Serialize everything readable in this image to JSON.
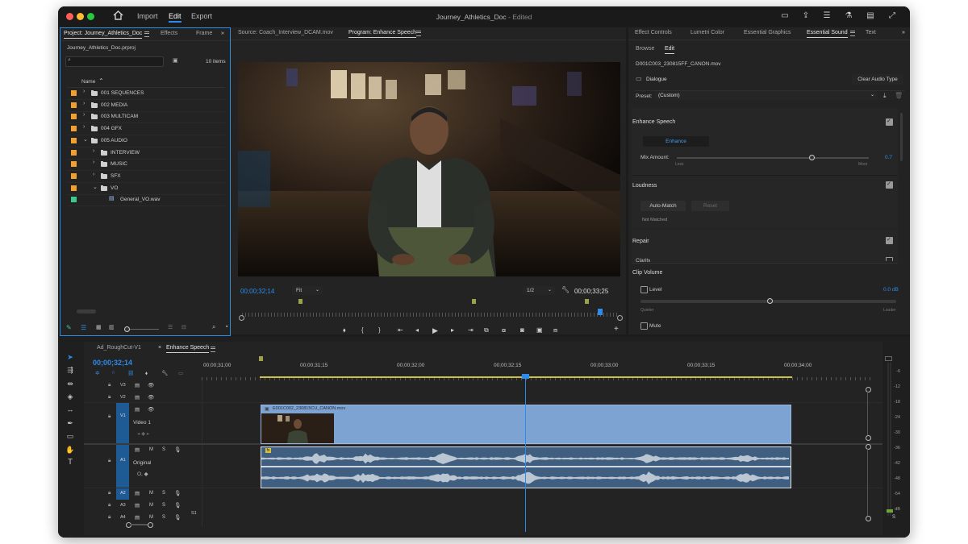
{
  "window": {
    "title": "Journey_Athletics_Doc",
    "edited": "- Edited",
    "menu": [
      "Import",
      "Edit",
      "Export"
    ],
    "active_menu": "Edit"
  },
  "project": {
    "tabs": [
      "Project: Journey_Athletics_Doc",
      "Effects",
      "Frame"
    ],
    "file": "Journey_Athletics_Doc.prproj",
    "count": "10 items",
    "column_name": "Name",
    "items": [
      {
        "label": "001 SEQUENCES",
        "color": "#f0a030",
        "indent": 0,
        "open": false,
        "type": "folder"
      },
      {
        "label": "002 MEDIA",
        "color": "#f0a030",
        "indent": 0,
        "open": false,
        "type": "folder"
      },
      {
        "label": "003 MULTICAM",
        "color": "#f0a030",
        "indent": 0,
        "open": false,
        "type": "folder"
      },
      {
        "label": "004 GFX",
        "color": "#f0a030",
        "indent": 0,
        "open": false,
        "type": "folder"
      },
      {
        "label": "005 AUDIO",
        "color": "#f0a030",
        "indent": 0,
        "open": true,
        "type": "folder"
      },
      {
        "label": "INTERVIEW",
        "color": "#f0a030",
        "indent": 1,
        "open": false,
        "type": "folder"
      },
      {
        "label": "MUSIC",
        "color": "#f0a030",
        "indent": 1,
        "open": false,
        "type": "folder"
      },
      {
        "label": "SFX",
        "color": "#f0a030",
        "indent": 1,
        "open": false,
        "type": "folder"
      },
      {
        "label": "VO",
        "color": "#f0a030",
        "indent": 1,
        "open": true,
        "type": "folder"
      },
      {
        "label": "General_VO.wav",
        "color": "#3cc98a",
        "indent": 2,
        "open": false,
        "type": "audio"
      }
    ]
  },
  "monitor": {
    "tabs": [
      "Source: Coach_Interview_DCAM.mov",
      "Program: Enhance Speech"
    ],
    "timecode": "00;00;32;14",
    "fit": "Fit",
    "resolution": "1/2",
    "duration": "00;00;33;25"
  },
  "essential_sound": {
    "tabs": [
      "Effect Controls",
      "Lumetri Color",
      "Essential Graphics",
      "Essential Sound",
      "Text"
    ],
    "subtabs": [
      "Browse",
      "Edit"
    ],
    "clip": "D001C003_230815FF_CANON.mov",
    "type": "Dialogue",
    "clear_button": "Clear Audio Type",
    "preset_label": "Preset:",
    "preset_value": "(Custom)",
    "enhance_speech": "Enhance Speech",
    "enhance_button": "Enhance",
    "mix_amount_label": "Mix Amount:",
    "mix_amount_value": "0.7",
    "mix_amount_fraction": 0.7,
    "less": "Less",
    "more": "More",
    "loudness": "Loudness",
    "auto_match": "Auto-Match",
    "reset": "Reset",
    "not_matched": "Not Matched",
    "repair": "Repair",
    "clarity": "Clarity",
    "clip_volume": "Clip Volume",
    "level_label": "Level",
    "level_value": "0.0 dB",
    "quieter": "Quieter",
    "louder": "Louder",
    "mute": "Mute"
  },
  "timeline": {
    "tabs": [
      "Ad_RoughCut-V1",
      "Enhance Speech"
    ],
    "timecode": "00;00;32;14",
    "ruler": [
      "00;00;31;00",
      "00;00;31;15",
      "00;00;32;00",
      "00;00;32;15",
      "00;00;33;00",
      "00;00;33;15",
      "00;00;34;00"
    ],
    "tracks": {
      "v3": "V3",
      "v2": "V2",
      "v1": "V1",
      "video1": "Video 1",
      "a1": "A1",
      "original": "Original",
      "a2": "A2",
      "a3": "A3",
      "a4": "A4",
      "s1": "S1",
      "m": "M",
      "s": "S"
    },
    "video_clip": "E001C002_230815CU_CANON.mov",
    "audio_clip_badge": "fx"
  },
  "meter": {
    "labels": [
      "-6",
      "-12",
      "-18",
      "-24",
      "-30",
      "-36",
      "-42",
      "-48",
      "-54",
      "dB"
    ],
    "solo": "S"
  },
  "colors": {
    "accent": "#2d8ceb",
    "clip_video": "#7da3d3",
    "clip_audio": "#3f5e80",
    "folder": "#f0a030",
    "audio_file": "#3cc98a"
  }
}
